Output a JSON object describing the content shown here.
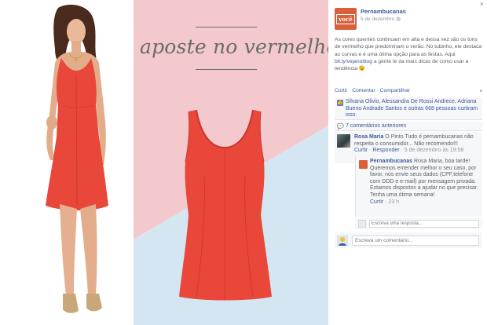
{
  "photo": {
    "headline": "aposte no vermelho",
    "colors": {
      "pink": "#f2c9cd",
      "blue": "#cfe2f1",
      "dress": "#e8473a"
    }
  },
  "post": {
    "page_name": "Pernambucanas",
    "avatar_text": "você",
    "timestamp": "5 de dezembro",
    "privacy_icon": "globe-icon",
    "close_label": "×",
    "body_before_link": "As cores quentes continuam em alta e dessa vez são os tons de vermelho que predominam o verão. No tubinho, ele destaca as curvas e é uma ótima opção para as festas. Aqui ",
    "body_link": "bit.ly/vejanoblog",
    "body_after_link": " a gente te da mais dicas de como usar a tendência 😉",
    "actions": {
      "like": "Curtir",
      "comment": "Comentar",
      "share": "Compartilhar"
    }
  },
  "likes": {
    "text": "Silvana Olivio, Alessandra De Rossi Andrece, Adriana Bueno Andrade Santos e outras 668 pessoas curtiram isso.",
    "replies_link": "7 comentários anteriores"
  },
  "comment": {
    "author": "Rosa Maria",
    "text": " O Pinto Tudo é pernambucanas não respeita o consumidor... Não recomendo!!!",
    "actions": "Curtir · Responder",
    "time": " · 5 de dezembro às 19:58"
  },
  "reply": {
    "author": "Pernambucanas",
    "text": " Rosa Maria, boa tarde! Queremos entender melhor o seu caso, por favor, nos envie seus dados (CPF,telefone com DDD e e-mail) por mensagem privada. Estamos dispostos a ajudar no que precisar. Tenha uma ótima semana!",
    "actions": "Curtir",
    "time": " · 23 h"
  },
  "reply_box": {
    "placeholder": "Escreva uma resposta..."
  },
  "comment_box": {
    "placeholder": "Escreva um comentário..."
  }
}
